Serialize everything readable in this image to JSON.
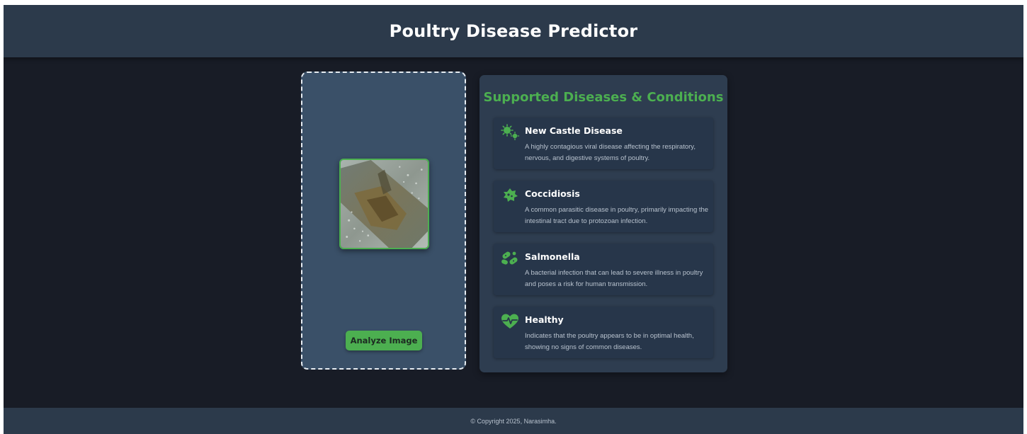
{
  "header": {
    "title": "Poultry Disease Predictor"
  },
  "upload": {
    "analyze_label": "Analyze Image"
  },
  "diseases": {
    "title": "Supported Diseases & Conditions",
    "items": [
      {
        "name": "New Castle Disease",
        "description": "A highly contagious viral disease affecting the respiratory, nervous, and digestive systems of poultry.",
        "icon": "virus-icon"
      },
      {
        "name": "Coccidiosis",
        "description": "A common parasitic disease in poultry, primarily impacting the intestinal tract due to protozoan infection.",
        "icon": "parasite-icon"
      },
      {
        "name": "Salmonella",
        "description": "A bacterial infection that can lead to severe illness in poultry and poses a risk for human transmission.",
        "icon": "bacteria-icon"
      },
      {
        "name": "Healthy",
        "description": "Indicates that the poultry appears to be in optimal health, showing no signs of common diseases.",
        "icon": "heart-pulse-icon"
      }
    ]
  },
  "footer": {
    "copyright": "© Copyright 2025, Narasimha."
  },
  "colors": {
    "accent": "#4caf50",
    "header_bg": "#2c3a4b",
    "page_bg": "#181c26",
    "upload_bg": "#3a5068",
    "panel_bg": "#2e3d50",
    "card_bg": "#27364a"
  }
}
